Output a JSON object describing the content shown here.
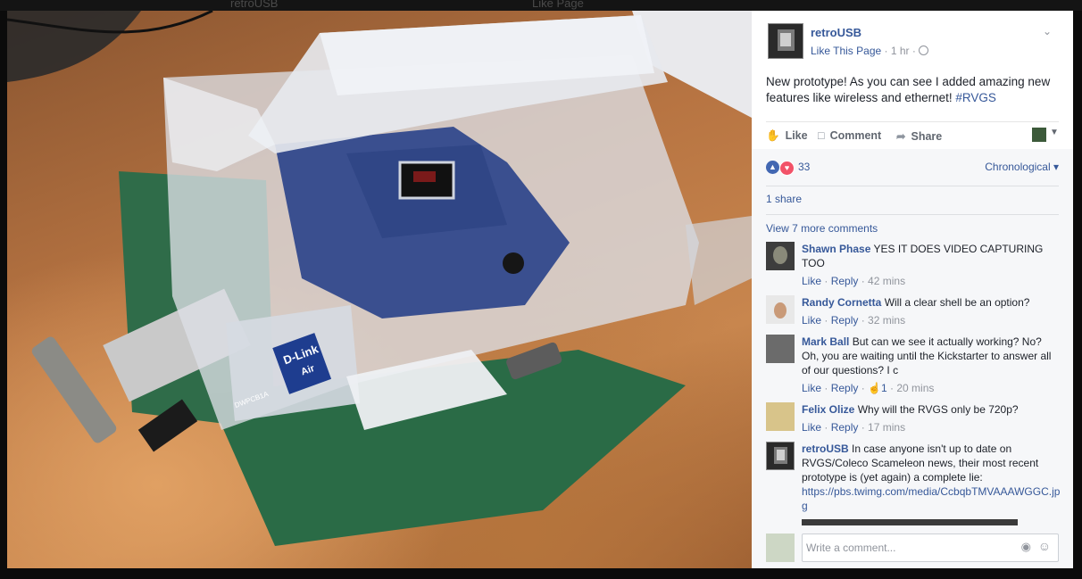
{
  "backdrop": {
    "left_text": "retroUSB",
    "center_text": "Like Page"
  },
  "post": {
    "page_name": "retroUSB",
    "like_page": "Like This Page",
    "time": "1 hr",
    "text": "New prototype! As you can see I added amazing new features like wireless and ethernet!",
    "hashtag": "#RVGS",
    "actions": {
      "like": "Like",
      "comment": "Comment",
      "share": "Share"
    },
    "reaction_count": "33",
    "sort_label": "Chronological",
    "shares": "1 share",
    "view_more": "View 7 more comments"
  },
  "photo": {
    "card_brand": "D-Link",
    "card_brand_sub": "Air",
    "card_model": "DWPCB1A"
  },
  "comments": [
    {
      "name": "Shawn Phase",
      "text": "YES IT DOES VIDEO CAPTURING TOO",
      "like": "Like",
      "reply": "Reply",
      "time": "42 mins"
    },
    {
      "name": "Randy Cornetta",
      "text": "Will a clear shell be an option?",
      "like": "Like",
      "reply": "Reply",
      "time": "32 mins"
    },
    {
      "name": "Mark Ball",
      "text": "But can we see it actually working? No? Oh, you are waiting until the Kickstarter to answer all of our questions? I c",
      "like": "Like",
      "reply": "Reply",
      "likes": "1",
      "time": "20 mins"
    },
    {
      "name": "Felix Olize",
      "text": "Why will the RVGS only be 720p?",
      "like": "Like",
      "reply": "Reply",
      "time": "17 mins"
    },
    {
      "name": "retroUSB",
      "text": "In case anyone isn't up to date on RVGS/Coleco Scameleon news, their most recent prototype is (yet again) a complete lie:",
      "link": "https://pbs.twimg.com/media/CcbqbTMVAAAWGGC.jpg"
    }
  ],
  "composer": {
    "placeholder": "Write a comment..."
  },
  "icons": [
    "globe-icon",
    "chevron-down-icon",
    "like-icon",
    "comment-icon",
    "share-icon",
    "love-icon",
    "camera-icon",
    "emoji-icon"
  ],
  "colors": {
    "link": "#365899",
    "panel_bg": "#f6f7f9",
    "like_reaction": "#4267b2",
    "love_reaction": "#f25268"
  }
}
